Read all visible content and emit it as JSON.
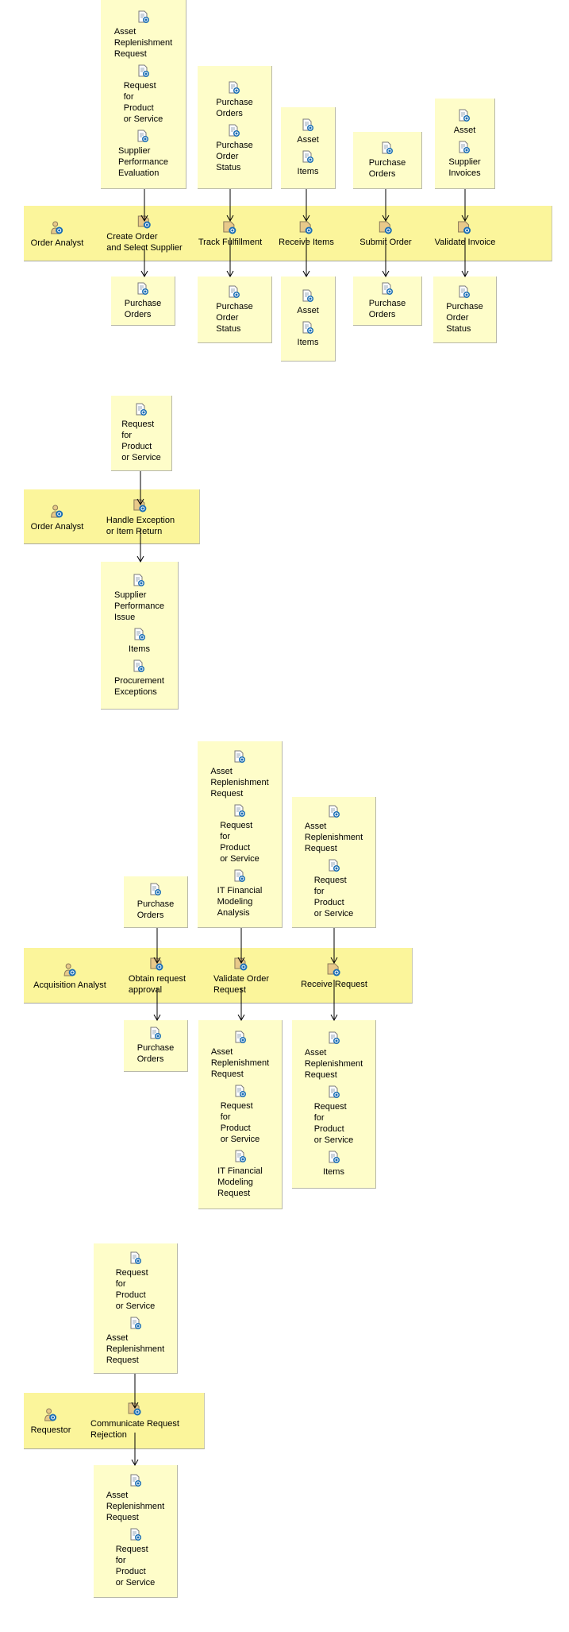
{
  "colors": {
    "lane": "#fbf59b",
    "box": "#fefdc9",
    "icon_blue": "#1c6fb5",
    "icon_tan": "#e8c98a"
  },
  "diagrams": [
    {
      "actor": "Order Analyst",
      "activities": [
        {
          "label": "Create Order\nand Select Supplier",
          "inputs": [
            "Asset\nReplenishment\nRequest",
            "Request\nfor\nProduct\nor Service",
            "Supplier\nPerformance\nEvaluation"
          ],
          "outputs": [
            "Purchase\nOrders"
          ]
        },
        {
          "label": "Track Fulfillment",
          "inputs": [
            "Purchase\nOrders",
            "Purchase\nOrder\nStatus"
          ],
          "outputs": [
            "Purchase\nOrder\nStatus"
          ]
        },
        {
          "label": "Receive Items",
          "inputs": [
            "Asset",
            "Items"
          ],
          "outputs": [
            "Asset",
            "Items"
          ]
        },
        {
          "label": "Submit Order",
          "inputs": [
            "Purchase\nOrders"
          ],
          "outputs": [
            "Purchase\nOrders"
          ]
        },
        {
          "label": "Validate Invoice",
          "inputs": [
            "Asset",
            "Supplier\nInvoices"
          ],
          "outputs": [
            "Purchase\nOrder\nStatus"
          ]
        }
      ]
    },
    {
      "actor": "Order Analyst",
      "activities": [
        {
          "label": "Handle Exception\nor Item Return",
          "inputs": [
            "Request\nfor\nProduct\nor Service"
          ],
          "outputs": [
            "Supplier\nPerformance\nIssue",
            "Items",
            "Procurement\nExceptions"
          ]
        }
      ]
    },
    {
      "actor": "Acquisition Analyst",
      "activities": [
        {
          "label": "Obtain request\napproval",
          "inputs": [
            "Purchase\nOrders"
          ],
          "outputs": [
            "Purchase\nOrders"
          ]
        },
        {
          "label": "Validate Order\nRequest",
          "inputs": [
            "Asset\nReplenishment\nRequest",
            "Request\nfor\nProduct\nor Service",
            "IT Financial\nModeling\nAnalysis"
          ],
          "outputs": [
            "Asset\nReplenishment\nRequest",
            "Request\nfor\nProduct\nor Service",
            "IT Financial\nModeling\nRequest"
          ]
        },
        {
          "label": "Receive Request",
          "inputs": [
            "Asset\nReplenishment\nRequest",
            "Request\nfor\nProduct\nor Service"
          ],
          "outputs": [
            "Asset\nReplenishment\nRequest",
            "Request\nfor\nProduct\nor Service",
            "Items"
          ]
        }
      ]
    },
    {
      "actor": "Requestor",
      "activities": [
        {
          "label": "Communicate Request\nRejection",
          "inputs": [
            "Request\nfor\nProduct\nor Service",
            "Asset\nReplenishment\nRequest"
          ],
          "outputs": [
            "Asset\nReplenishment\nRequest",
            "Request\nfor\nProduct\nor Service"
          ]
        }
      ]
    }
  ]
}
